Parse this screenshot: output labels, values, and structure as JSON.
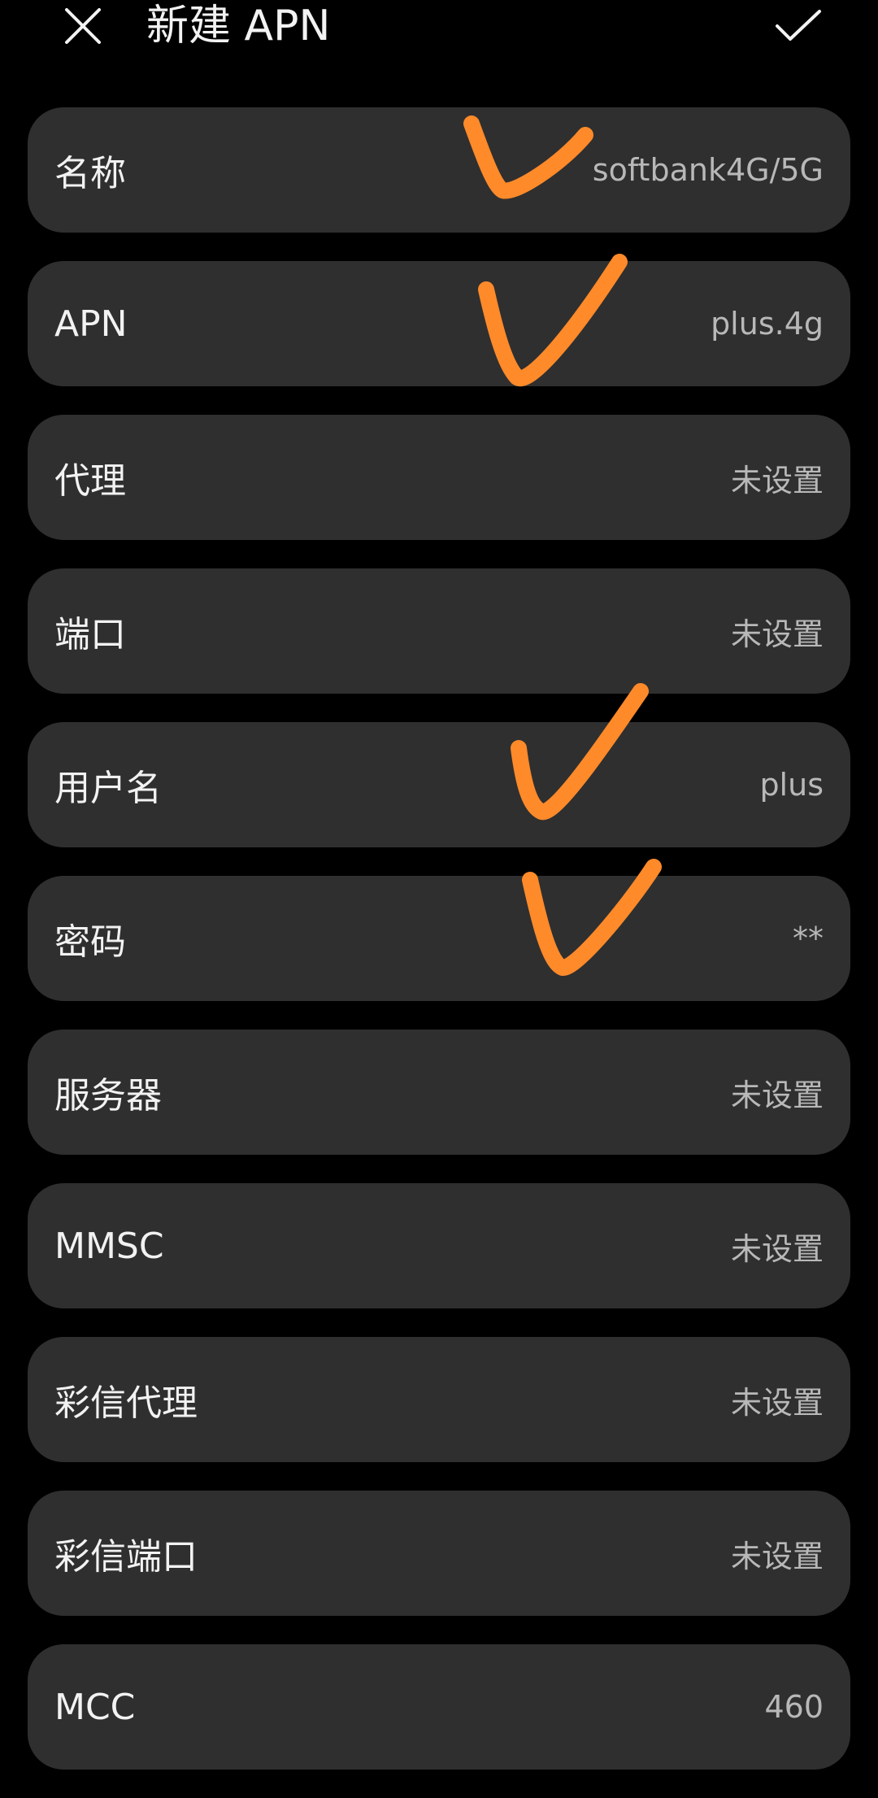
{
  "header": {
    "title": "新建 APN",
    "close_icon": "close-icon",
    "confirm_icon": "checkmark-icon"
  },
  "fields": [
    {
      "key": "name",
      "label": "名称",
      "value": "softbank4G/5G"
    },
    {
      "key": "apn",
      "label": "APN",
      "value": "plus.4g"
    },
    {
      "key": "proxy",
      "label": "代理",
      "value": "未设置"
    },
    {
      "key": "port",
      "label": "端口",
      "value": "未设置"
    },
    {
      "key": "username",
      "label": "用户名",
      "value": "plus"
    },
    {
      "key": "password",
      "label": "密码",
      "value": "**"
    },
    {
      "key": "server",
      "label": "服务器",
      "value": "未设置"
    },
    {
      "key": "mmsc",
      "label": "MMSC",
      "value": "未设置"
    },
    {
      "key": "mms-proxy",
      "label": "彩信代理",
      "value": "未设置"
    },
    {
      "key": "mms-port",
      "label": "彩信端口",
      "value": "未设置"
    },
    {
      "key": "mcc",
      "label": "MCC",
      "value": "460"
    }
  ],
  "colors": {
    "background": "#000000",
    "row_background": "#2f2f2f",
    "label_text": "#f2f2f2",
    "value_text": "#b8b8b8",
    "annotation_mark": "#ff8a2a"
  }
}
